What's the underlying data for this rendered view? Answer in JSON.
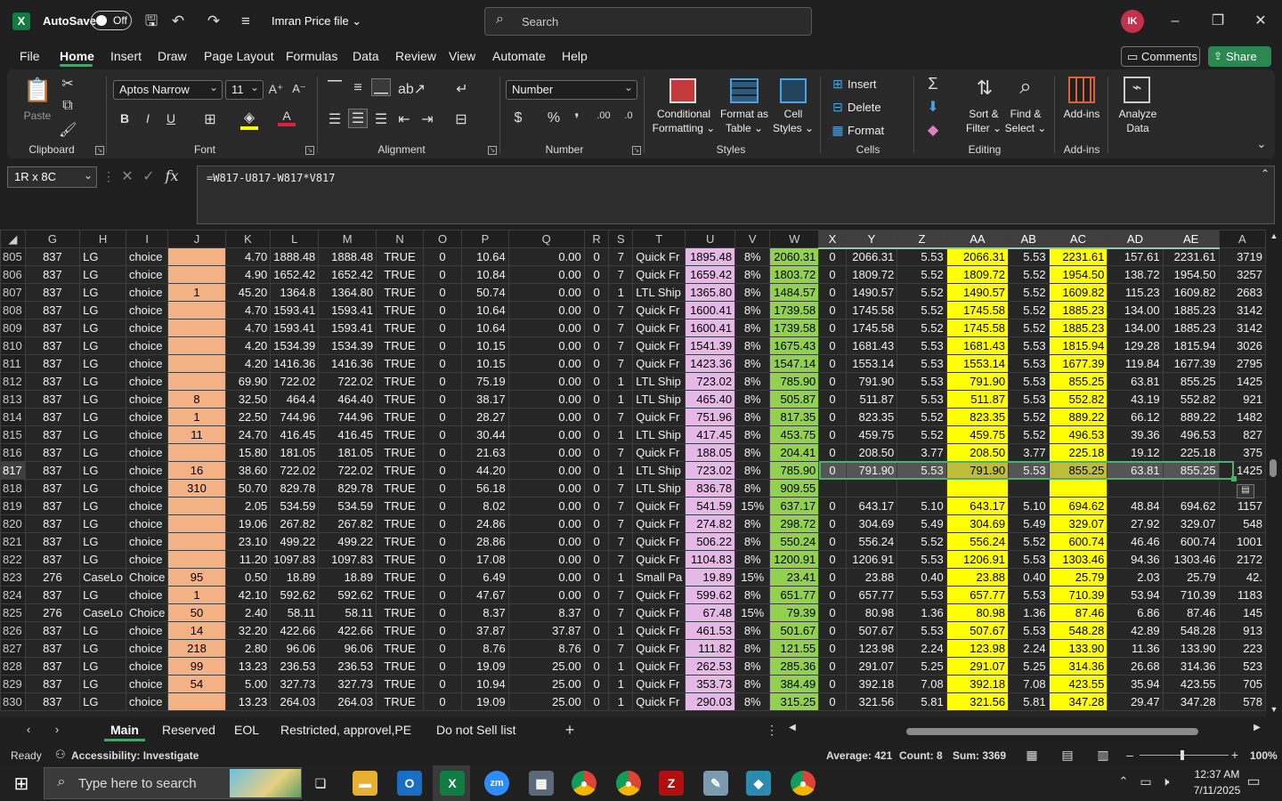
{
  "titlebar": {
    "autosave": "AutoSave",
    "toggle": "Off",
    "filename": "Imran Price file ⌄",
    "search": "Search",
    "avatar": "IK"
  },
  "menu": [
    "File",
    "Home",
    "Insert",
    "Draw",
    "Page Layout",
    "Formulas",
    "Data",
    "Review",
    "View",
    "Automate",
    "Help"
  ],
  "comments": "Comments",
  "share": "Share",
  "ribbon": {
    "paste": "Paste",
    "clipboard": "Clipboard",
    "font_name": "Aptos Narrow",
    "font_size": "11",
    "font": "Font",
    "alignment": "Alignment",
    "number_format": "Number",
    "number": "Number",
    "conditional": "Conditional Formatting ⌄",
    "format_table": "Format as Table ⌄",
    "cell_styles": "Cell Styles ⌄",
    "styles": "Styles",
    "insert": "Insert",
    "delete": "Delete",
    "format": "Format",
    "cells": "Cells",
    "sort": "Sort & Filter ⌄",
    "find": "Find & Select ⌄",
    "editing": "Editing",
    "addins": "Add-ins",
    "addins_group": "Add-ins",
    "analyze": "Analyze Data"
  },
  "namebox": "1R x 8C",
  "formula": "=W817-U817-W817*V817",
  "columns": [
    "G",
    "H",
    "I",
    "J",
    "K",
    "L",
    "M",
    "N",
    "O",
    "P",
    "Q",
    "R",
    "S",
    "T",
    "U",
    "V",
    "W",
    "X",
    "Y",
    "Z",
    "AA",
    "AB",
    "AC",
    "AD",
    "AE",
    "A"
  ],
  "rows": [
    [
      "805",
      "837",
      "LG",
      "choice",
      "",
      "4.70",
      "1888.48",
      "1888.48",
      "TRUE",
      "0",
      "10.64",
      "0.00",
      "0",
      "7",
      "Quick Fr",
      "1895.48",
      "8%",
      "2060.31",
      "0",
      "2066.31",
      "5.53",
      "2066.31",
      "5.53",
      "2231.61",
      "157.61",
      "2231.61",
      "3719"
    ],
    [
      "806",
      "837",
      "LG",
      "choice",
      "",
      "4.90",
      "1652.42",
      "1652.42",
      "TRUE",
      "0",
      "10.84",
      "0.00",
      "0",
      "7",
      "Quick Fr",
      "1659.42",
      "8%",
      "1803.72",
      "0",
      "1809.72",
      "5.52",
      "1809.72",
      "5.52",
      "1954.50",
      "138.72",
      "1954.50",
      "3257"
    ],
    [
      "807",
      "837",
      "LG",
      "choice",
      "1",
      "45.20",
      "1364.8",
      "1364.80",
      "TRUE",
      "0",
      "50.74",
      "0.00",
      "0",
      "1",
      "LTL Ship",
      "1365.80",
      "8%",
      "1484.57",
      "0",
      "1490.57",
      "5.52",
      "1490.57",
      "5.52",
      "1609.82",
      "115.23",
      "1609.82",
      "2683"
    ],
    [
      "808",
      "837",
      "LG",
      "choice",
      "",
      "4.70",
      "1593.41",
      "1593.41",
      "TRUE",
      "0",
      "10.64",
      "0.00",
      "0",
      "7",
      "Quick Fr",
      "1600.41",
      "8%",
      "1739.58",
      "0",
      "1745.58",
      "5.52",
      "1745.58",
      "5.52",
      "1885.23",
      "134.00",
      "1885.23",
      "3142"
    ],
    [
      "809",
      "837",
      "LG",
      "choice",
      "",
      "4.70",
      "1593.41",
      "1593.41",
      "TRUE",
      "0",
      "10.64",
      "0.00",
      "0",
      "7",
      "Quick Fr",
      "1600.41",
      "8%",
      "1739.58",
      "0",
      "1745.58",
      "5.52",
      "1745.58",
      "5.52",
      "1885.23",
      "134.00",
      "1885.23",
      "3142"
    ],
    [
      "810",
      "837",
      "LG",
      "choice",
      "",
      "4.20",
      "1534.39",
      "1534.39",
      "TRUE",
      "0",
      "10.15",
      "0.00",
      "0",
      "7",
      "Quick Fr",
      "1541.39",
      "8%",
      "1675.43",
      "0",
      "1681.43",
      "5.53",
      "1681.43",
      "5.53",
      "1815.94",
      "129.28",
      "1815.94",
      "3026"
    ],
    [
      "811",
      "837",
      "LG",
      "choice",
      "",
      "4.20",
      "1416.36",
      "1416.36",
      "TRUE",
      "0",
      "10.15",
      "0.00",
      "0",
      "7",
      "Quick Fr",
      "1423.36",
      "8%",
      "1547.14",
      "0",
      "1553.14",
      "5.53",
      "1553.14",
      "5.53",
      "1677.39",
      "119.84",
      "1677.39",
      "2795"
    ],
    [
      "812",
      "837",
      "LG",
      "choice",
      "",
      "69.90",
      "722.02",
      "722.02",
      "TRUE",
      "0",
      "75.19",
      "0.00",
      "0",
      "1",
      "LTL Ship",
      "723.02",
      "8%",
      "785.90",
      "0",
      "791.90",
      "5.53",
      "791.90",
      "5.53",
      "855.25",
      "63.81",
      "855.25",
      "1425"
    ],
    [
      "813",
      "837",
      "LG",
      "choice",
      "8",
      "32.50",
      "464.4",
      "464.40",
      "TRUE",
      "0",
      "38.17",
      "0.00",
      "0",
      "1",
      "LTL Ship",
      "465.40",
      "8%",
      "505.87",
      "0",
      "511.87",
      "5.53",
      "511.87",
      "5.53",
      "552.82",
      "43.19",
      "552.82",
      "921"
    ],
    [
      "814",
      "837",
      "LG",
      "choice",
      "1",
      "22.50",
      "744.96",
      "744.96",
      "TRUE",
      "0",
      "28.27",
      "0.00",
      "0",
      "7",
      "Quick Fr",
      "751.96",
      "8%",
      "817.35",
      "0",
      "823.35",
      "5.52",
      "823.35",
      "5.52",
      "889.22",
      "66.12",
      "889.22",
      "1482"
    ],
    [
      "815",
      "837",
      "LG",
      "choice",
      "11",
      "24.70",
      "416.45",
      "416.45",
      "TRUE",
      "0",
      "30.44",
      "0.00",
      "0",
      "1",
      "LTL Ship",
      "417.45",
      "8%",
      "453.75",
      "0",
      "459.75",
      "5.52",
      "459.75",
      "5.52",
      "496.53",
      "39.36",
      "496.53",
      "827"
    ],
    [
      "816",
      "837",
      "LG",
      "choice",
      "",
      "15.80",
      "181.05",
      "181.05",
      "TRUE",
      "0",
      "21.63",
      "0.00",
      "0",
      "7",
      "Quick Fr",
      "188.05",
      "8%",
      "204.41",
      "0",
      "208.50",
      "3.77",
      "208.50",
      "3.77",
      "225.18",
      "19.12",
      "225.18",
      "375"
    ],
    [
      "817",
      "837",
      "LG",
      "choice",
      "16",
      "38.60",
      "722.02",
      "722.02",
      "TRUE",
      "0",
      "44.20",
      "0.00",
      "0",
      "1",
      "LTL Ship",
      "723.02",
      "8%",
      "785.90",
      "0",
      "791.90",
      "5.53",
      "791.90",
      "5.53",
      "855.25",
      "63.81",
      "855.25",
      "1425"
    ],
    [
      "818",
      "837",
      "LG",
      "choice",
      "310",
      "50.70",
      "829.78",
      "829.78",
      "TRUE",
      "0",
      "56.18",
      "0.00",
      "0",
      "7",
      "LTL Ship",
      "836.78",
      "8%",
      "909.55",
      "",
      "",
      "",
      "",
      "",
      "",
      "",
      "",
      ""
    ],
    [
      "819",
      "837",
      "LG",
      "choice",
      "",
      "2.05",
      "534.59",
      "534.59",
      "TRUE",
      "0",
      "8.02",
      "0.00",
      "0",
      "7",
      "Quick Fr",
      "541.59",
      "15%",
      "637.17",
      "0",
      "643.17",
      "5.10",
      "643.17",
      "5.10",
      "694.62",
      "48.84",
      "694.62",
      "1157"
    ],
    [
      "820",
      "837",
      "LG",
      "choice",
      "",
      "19.06",
      "267.82",
      "267.82",
      "TRUE",
      "0",
      "24.86",
      "0.00",
      "0",
      "7",
      "Quick Fr",
      "274.82",
      "8%",
      "298.72",
      "0",
      "304.69",
      "5.49",
      "304.69",
      "5.49",
      "329.07",
      "27.92",
      "329.07",
      "548"
    ],
    [
      "821",
      "837",
      "LG",
      "choice",
      "",
      "23.10",
      "499.22",
      "499.22",
      "TRUE",
      "0",
      "28.86",
      "0.00",
      "0",
      "7",
      "Quick Fr",
      "506.22",
      "8%",
      "550.24",
      "0",
      "556.24",
      "5.52",
      "556.24",
      "5.52",
      "600.74",
      "46.46",
      "600.74",
      "1001"
    ],
    [
      "822",
      "837",
      "LG",
      "choice",
      "",
      "11.20",
      "1097.83",
      "1097.83",
      "TRUE",
      "0",
      "17.08",
      "0.00",
      "0",
      "7",
      "Quick Fr",
      "1104.83",
      "8%",
      "1200.91",
      "0",
      "1206.91",
      "5.53",
      "1206.91",
      "5.53",
      "1303.46",
      "94.36",
      "1303.46",
      "2172"
    ],
    [
      "823",
      "276",
      "CaseLo",
      "Choice",
      "95",
      "0.50",
      "18.89",
      "18.89",
      "TRUE",
      "0",
      "6.49",
      "0.00",
      "0",
      "1",
      "Small Pa",
      "19.89",
      "15%",
      "23.41",
      "0",
      "23.88",
      "0.40",
      "23.88",
      "0.40",
      "25.79",
      "2.03",
      "25.79",
      "42."
    ],
    [
      "824",
      "837",
      "LG",
      "choice",
      "1",
      "42.10",
      "592.62",
      "592.62",
      "TRUE",
      "0",
      "47.67",
      "0.00",
      "0",
      "7",
      "Quick Fr",
      "599.62",
      "8%",
      "651.77",
      "0",
      "657.77",
      "5.53",
      "657.77",
      "5.53",
      "710.39",
      "53.94",
      "710.39",
      "1183"
    ],
    [
      "825",
      "276",
      "CaseLo",
      "Choice",
      "50",
      "2.40",
      "58.11",
      "58.11",
      "TRUE",
      "0",
      "8.37",
      "8.37",
      "0",
      "7",
      "Quick Fr",
      "67.48",
      "15%",
      "79.39",
      "0",
      "80.98",
      "1.36",
      "80.98",
      "1.36",
      "87.46",
      "6.86",
      "87.46",
      "145"
    ],
    [
      "826",
      "837",
      "LG",
      "choice",
      "14",
      "32.20",
      "422.66",
      "422.66",
      "TRUE",
      "0",
      "37.87",
      "37.87",
      "0",
      "1",
      "Quick Fr",
      "461.53",
      "8%",
      "501.67",
      "0",
      "507.67",
      "5.53",
      "507.67",
      "5.53",
      "548.28",
      "42.89",
      "548.28",
      "913"
    ],
    [
      "827",
      "837",
      "LG",
      "choice",
      "218",
      "2.80",
      "96.06",
      "96.06",
      "TRUE",
      "0",
      "8.76",
      "8.76",
      "0",
      "7",
      "Quick Fr",
      "111.82",
      "8%",
      "121.55",
      "0",
      "123.98",
      "2.24",
      "123.98",
      "2.24",
      "133.90",
      "11.36",
      "133.90",
      "223"
    ],
    [
      "828",
      "837",
      "LG",
      "choice",
      "99",
      "13.23",
      "236.53",
      "236.53",
      "TRUE",
      "0",
      "19.09",
      "25.00",
      "0",
      "1",
      "Quick Fr",
      "262.53",
      "8%",
      "285.36",
      "0",
      "291.07",
      "5.25",
      "291.07",
      "5.25",
      "314.36",
      "26.68",
      "314.36",
      "523"
    ],
    [
      "829",
      "837",
      "LG",
      "choice",
      "54",
      "5.00",
      "327.73",
      "327.73",
      "TRUE",
      "0",
      "10.94",
      "25.00",
      "0",
      "1",
      "Quick Fr",
      "353.73",
      "8%",
      "384.49",
      "0",
      "392.18",
      "7.08",
      "392.18",
      "7.08",
      "423.55",
      "35.94",
      "423.55",
      "705"
    ],
    [
      "830",
      "837",
      "LG",
      "choice",
      "",
      "13.23",
      "264.03",
      "264.03",
      "TRUE",
      "0",
      "19.09",
      "25.00",
      "0",
      "1",
      "Quick Fr",
      "290.03",
      "8%",
      "315.25",
      "0",
      "321.56",
      "5.81",
      "321.56",
      "5.81",
      "347.28",
      "29.47",
      "347.28",
      "578"
    ]
  ],
  "tabs": [
    "Main",
    "Reserved",
    "EOL",
    "Restricted, approvel,PE",
    "Do not Sell list"
  ],
  "status": {
    "ready": "Ready",
    "accessibility": "Accessibility: Investigate",
    "average": "Average: 421",
    "count": "Count: 8",
    "sum": "Sum: 3369",
    "zoom": "100%"
  },
  "taskbar": {
    "search": "Type here to search",
    "time": "12:37 AM",
    "date": "7/11/2025"
  }
}
